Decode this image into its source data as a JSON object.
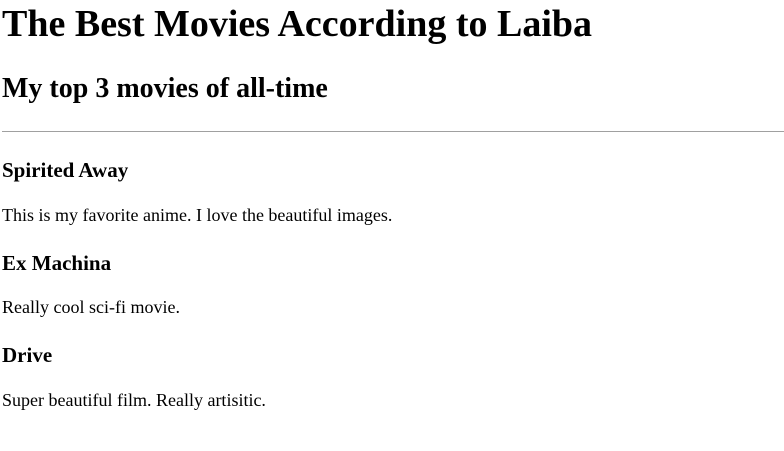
{
  "header": {
    "title": "The Best Movies According to Laiba",
    "subtitle": "My top 3 movies of all-time"
  },
  "movies": [
    {
      "title": "Spirited Away",
      "description": "This is my favorite anime. I love the beautiful images."
    },
    {
      "title": "Ex Machina",
      "description": "Really cool sci-fi movie."
    },
    {
      "title": "Drive",
      "description": "Super beautiful film. Really artisitic."
    }
  ]
}
